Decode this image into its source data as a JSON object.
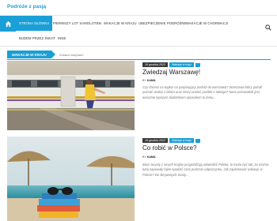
{
  "site": {
    "title": "Podróże z pasją"
  },
  "nav": {
    "items": [
      {
        "label": "STRONA GŁÓWNA"
      },
      {
        "label": "PIERWSZY LOT SAMOLOTEM"
      },
      {
        "label": "WAKACJE W KRAJU"
      },
      {
        "label": "UBEZPIECZENIE PODRÓŻNE"
      },
      {
        "label": "WAKACJE W CHORWACJI"
      },
      {
        "label": "BUDEM PRZEZ ŚWIAT"
      },
      {
        "label": "INNE"
      }
    ]
  },
  "section": {
    "tag": "WAKACJE W KRAJU",
    "link": "Zobacz wszystko"
  },
  "posts": [
    {
      "date": "16 grudnia 2022",
      "category": "Wakacje w kraju",
      "title": "Zwiedzaj Warszawę!",
      "author_prefix": "BY",
      "author": "KAMIL",
      "excerpt": "Czy chcesz na wyjkę! na pasjonujący podróż do warszawę? Warszawa który potrafi poznać stolicę z bliska oraz śmiej ucieleć posiłek z takiego? Nasz przewodnik jest wrecznie lepszym dodatnkiem sposobem tu temu..."
    },
    {
      "date": "16 grudnia 2022",
      "category": "Wakacje w kraju",
      "title": "Co robić w Polsce?",
      "author_prefix": "BY",
      "author": "KAMIL",
      "excerpt": "Biorn turysty z innych krajów przyjeżdżają odwiedzić Polskę, to może być tak, że można tutaj napewały fajne spędzić czas podczas odpoczynku. Jak zaplanować wakacje w Polsce? Do skrywanych Dusty..."
    }
  ]
}
